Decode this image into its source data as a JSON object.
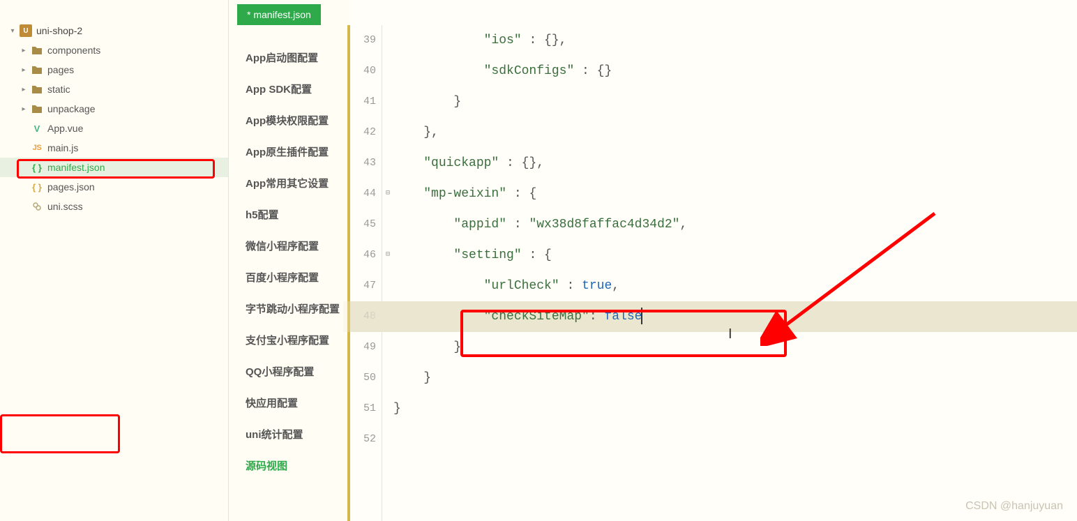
{
  "project": {
    "name": "uni-shop-2"
  },
  "tree": {
    "folders": [
      {
        "label": "components"
      },
      {
        "label": "pages"
      },
      {
        "label": "static"
      },
      {
        "label": "unpackage"
      }
    ],
    "files": [
      {
        "label": "App.vue",
        "icon": "vue"
      },
      {
        "label": "main.js",
        "icon": "js"
      },
      {
        "label": "manifest.json",
        "icon": "json-active",
        "selected": true
      },
      {
        "label": "pages.json",
        "icon": "json"
      },
      {
        "label": "uni.scss",
        "icon": "scss"
      }
    ]
  },
  "tab": {
    "label": "* manifest.json"
  },
  "config_sections": [
    "App启动图配置",
    "App SDK配置",
    "App模块权限配置",
    "App原生插件配置",
    "App常用其它设置",
    "h5配置",
    "微信小程序配置",
    "百度小程序配置",
    "字节跳动小程序配置",
    "支付宝小程序配置",
    "QQ小程序配置",
    "快应用配置",
    "uni统计配置",
    "源码视图"
  ],
  "active_section_index": 13,
  "line_numbers": [
    39,
    40,
    41,
    42,
    43,
    44,
    45,
    46,
    47,
    48,
    49,
    50,
    51,
    52
  ],
  "fold_markers": {
    "44": "⊟",
    "46": "⊟"
  },
  "code_lines": [
    {
      "indent": 3,
      "tokens": [
        {
          "t": "str",
          "v": "\"ios\""
        },
        {
          "t": "punc",
          "v": " : {},"
        }
      ]
    },
    {
      "indent": 3,
      "tokens": [
        {
          "t": "str",
          "v": "\"sdkConfigs\""
        },
        {
          "t": "punc",
          "v": " : {}"
        }
      ]
    },
    {
      "indent": 2,
      "tokens": [
        {
          "t": "punc",
          "v": "}"
        }
      ]
    },
    {
      "indent": 1,
      "tokens": [
        {
          "t": "punc",
          "v": "},"
        }
      ]
    },
    {
      "indent": 1,
      "tokens": [
        {
          "t": "str",
          "v": "\"quickapp\""
        },
        {
          "t": "punc",
          "v": " : {},"
        }
      ]
    },
    {
      "indent": 1,
      "tokens": [
        {
          "t": "str",
          "v": "\"mp-weixin\""
        },
        {
          "t": "punc",
          "v": " : {"
        }
      ]
    },
    {
      "indent": 2,
      "tokens": [
        {
          "t": "str",
          "v": "\"appid\""
        },
        {
          "t": "punc",
          "v": " : "
        },
        {
          "t": "str",
          "v": "\"wx38d8faffac4d34d2\""
        },
        {
          "t": "punc",
          "v": ","
        }
      ]
    },
    {
      "indent": 2,
      "tokens": [
        {
          "t": "str",
          "v": "\"setting\""
        },
        {
          "t": "punc",
          "v": " : {"
        }
      ]
    },
    {
      "indent": 3,
      "tokens": [
        {
          "t": "str",
          "v": "\"urlCheck\""
        },
        {
          "t": "punc",
          "v": " : "
        },
        {
          "t": "kw-true",
          "v": "true"
        },
        {
          "t": "punc",
          "v": ","
        }
      ]
    },
    {
      "indent": 3,
      "current": true,
      "tokens": [
        {
          "t": "str",
          "v": "\"checkSiteMap\""
        },
        {
          "t": "punc",
          "v": ": "
        },
        {
          "t": "kw-false",
          "v": "false"
        }
      ],
      "cursor_after": true
    },
    {
      "indent": 2,
      "tokens": [
        {
          "t": "punc",
          "v": "}"
        }
      ]
    },
    {
      "indent": 1,
      "tokens": [
        {
          "t": "punc",
          "v": "}"
        }
      ]
    },
    {
      "indent": 0,
      "tokens": [
        {
          "t": "punc",
          "v": "}"
        }
      ]
    },
    {
      "indent": 0,
      "tokens": []
    }
  ],
  "watermark": "CSDN @hanjuyuan"
}
